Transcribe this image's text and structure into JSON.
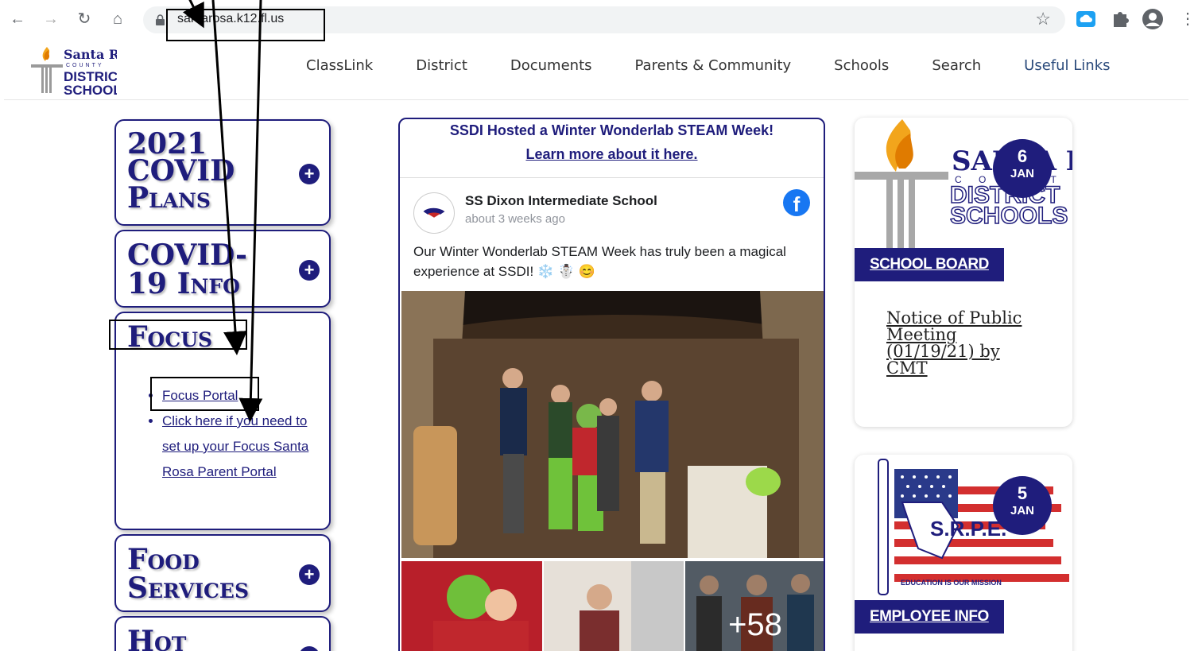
{
  "browser": {
    "url": "santarosa.k12.fl.us",
    "back_icon": "back-arrow-icon",
    "forward_icon": "forward-arrow-icon",
    "reload_icon": "reload-icon",
    "home_icon": "home-icon"
  },
  "header": {
    "logo_line1": "Santa Rosa",
    "logo_line2": "COUNTY",
    "logo_line3": "DISTRICT",
    "logo_line4": "SCHOOLS",
    "nav": [
      "ClassLink",
      "District",
      "Documents",
      "Parents & Community",
      "Schools",
      "Search",
      "Useful Links"
    ]
  },
  "accordion": {
    "covid_plans": "2021 COVID Plans",
    "covid_plans_l1": "2021",
    "covid_plans_l2": "COVID",
    "covid_plans_l3": "Plans",
    "covid_info_l1": "COVID-",
    "covid_info_l2": "19 Info",
    "focus": "Focus",
    "focus_links": [
      "Focus Portal",
      "Click here if you need to set up your Focus Santa Rosa Parent Portal"
    ],
    "food_l1": "Food",
    "food_l2": "Services",
    "hot": "Hot"
  },
  "post": {
    "headline": "SSDI Hosted a Winter Wonderlab STEAM Week!",
    "learn_more": "Learn more about it here.",
    "author": "SS Dixon Intermediate School",
    "time": "about 3 weeks ago",
    "text": "Our Winter Wonderlab STEAM Week has truly been a magical experience at SSDI! ❄️ ☃️ 😊",
    "more_count": "+58"
  },
  "cards": [
    {
      "label": "SCHOOL BOARD",
      "day": "6",
      "month": "JAN",
      "notice": "Notice of Public Meeting (01/19/21) by CMT",
      "logo_line1": "SANTA ROSA",
      "logo_line2": "C O U N T Y",
      "logo_line3": "DISTRICT",
      "logo_line4": "SCHOOLS"
    },
    {
      "label": "EMPLOYEE INFO",
      "day": "5",
      "month": "JAN",
      "logo_text": "S.R.P.E.",
      "logo_sub": "EDUCATION IS OUR MISSION"
    }
  ],
  "colors": {
    "brand_navy": "#1f1d7c",
    "facebook": "#1877f2"
  }
}
